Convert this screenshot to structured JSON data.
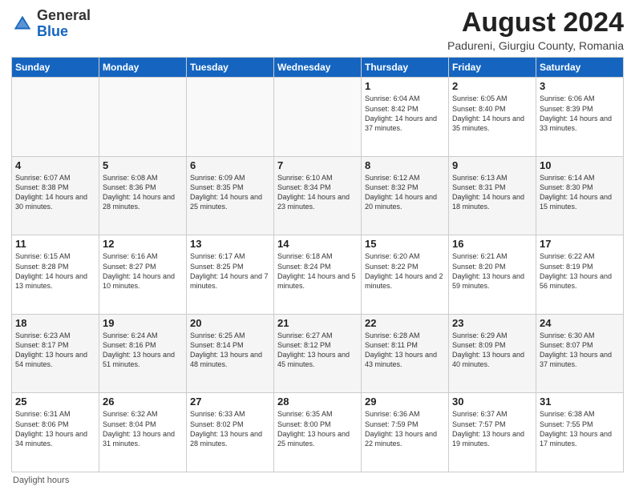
{
  "header": {
    "logo_general": "General",
    "logo_blue": "Blue",
    "month_year": "August 2024",
    "location": "Padureni, Giurgiu County, Romania"
  },
  "weekdays": [
    "Sunday",
    "Monday",
    "Tuesday",
    "Wednesday",
    "Thursday",
    "Friday",
    "Saturday"
  ],
  "footer": {
    "daylight_label": "Daylight hours"
  },
  "weeks": [
    [
      {
        "day": "",
        "info": ""
      },
      {
        "day": "",
        "info": ""
      },
      {
        "day": "",
        "info": ""
      },
      {
        "day": "",
        "info": ""
      },
      {
        "day": "1",
        "info": "Sunrise: 6:04 AM\nSunset: 8:42 PM\nDaylight: 14 hours\nand 37 minutes."
      },
      {
        "day": "2",
        "info": "Sunrise: 6:05 AM\nSunset: 8:40 PM\nDaylight: 14 hours\nand 35 minutes."
      },
      {
        "day": "3",
        "info": "Sunrise: 6:06 AM\nSunset: 8:39 PM\nDaylight: 14 hours\nand 33 minutes."
      }
    ],
    [
      {
        "day": "4",
        "info": "Sunrise: 6:07 AM\nSunset: 8:38 PM\nDaylight: 14 hours\nand 30 minutes."
      },
      {
        "day": "5",
        "info": "Sunrise: 6:08 AM\nSunset: 8:36 PM\nDaylight: 14 hours\nand 28 minutes."
      },
      {
        "day": "6",
        "info": "Sunrise: 6:09 AM\nSunset: 8:35 PM\nDaylight: 14 hours\nand 25 minutes."
      },
      {
        "day": "7",
        "info": "Sunrise: 6:10 AM\nSunset: 8:34 PM\nDaylight: 14 hours\nand 23 minutes."
      },
      {
        "day": "8",
        "info": "Sunrise: 6:12 AM\nSunset: 8:32 PM\nDaylight: 14 hours\nand 20 minutes."
      },
      {
        "day": "9",
        "info": "Sunrise: 6:13 AM\nSunset: 8:31 PM\nDaylight: 14 hours\nand 18 minutes."
      },
      {
        "day": "10",
        "info": "Sunrise: 6:14 AM\nSunset: 8:30 PM\nDaylight: 14 hours\nand 15 minutes."
      }
    ],
    [
      {
        "day": "11",
        "info": "Sunrise: 6:15 AM\nSunset: 8:28 PM\nDaylight: 14 hours\nand 13 minutes."
      },
      {
        "day": "12",
        "info": "Sunrise: 6:16 AM\nSunset: 8:27 PM\nDaylight: 14 hours\nand 10 minutes."
      },
      {
        "day": "13",
        "info": "Sunrise: 6:17 AM\nSunset: 8:25 PM\nDaylight: 14 hours\nand 7 minutes."
      },
      {
        "day": "14",
        "info": "Sunrise: 6:18 AM\nSunset: 8:24 PM\nDaylight: 14 hours\nand 5 minutes."
      },
      {
        "day": "15",
        "info": "Sunrise: 6:20 AM\nSunset: 8:22 PM\nDaylight: 14 hours\nand 2 minutes."
      },
      {
        "day": "16",
        "info": "Sunrise: 6:21 AM\nSunset: 8:20 PM\nDaylight: 13 hours\nand 59 minutes."
      },
      {
        "day": "17",
        "info": "Sunrise: 6:22 AM\nSunset: 8:19 PM\nDaylight: 13 hours\nand 56 minutes."
      }
    ],
    [
      {
        "day": "18",
        "info": "Sunrise: 6:23 AM\nSunset: 8:17 PM\nDaylight: 13 hours\nand 54 minutes."
      },
      {
        "day": "19",
        "info": "Sunrise: 6:24 AM\nSunset: 8:16 PM\nDaylight: 13 hours\nand 51 minutes."
      },
      {
        "day": "20",
        "info": "Sunrise: 6:25 AM\nSunset: 8:14 PM\nDaylight: 13 hours\nand 48 minutes."
      },
      {
        "day": "21",
        "info": "Sunrise: 6:27 AM\nSunset: 8:12 PM\nDaylight: 13 hours\nand 45 minutes."
      },
      {
        "day": "22",
        "info": "Sunrise: 6:28 AM\nSunset: 8:11 PM\nDaylight: 13 hours\nand 43 minutes."
      },
      {
        "day": "23",
        "info": "Sunrise: 6:29 AM\nSunset: 8:09 PM\nDaylight: 13 hours\nand 40 minutes."
      },
      {
        "day": "24",
        "info": "Sunrise: 6:30 AM\nSunset: 8:07 PM\nDaylight: 13 hours\nand 37 minutes."
      }
    ],
    [
      {
        "day": "25",
        "info": "Sunrise: 6:31 AM\nSunset: 8:06 PM\nDaylight: 13 hours\nand 34 minutes."
      },
      {
        "day": "26",
        "info": "Sunrise: 6:32 AM\nSunset: 8:04 PM\nDaylight: 13 hours\nand 31 minutes."
      },
      {
        "day": "27",
        "info": "Sunrise: 6:33 AM\nSunset: 8:02 PM\nDaylight: 13 hours\nand 28 minutes."
      },
      {
        "day": "28",
        "info": "Sunrise: 6:35 AM\nSunset: 8:00 PM\nDaylight: 13 hours\nand 25 minutes."
      },
      {
        "day": "29",
        "info": "Sunrise: 6:36 AM\nSunset: 7:59 PM\nDaylight: 13 hours\nand 22 minutes."
      },
      {
        "day": "30",
        "info": "Sunrise: 6:37 AM\nSunset: 7:57 PM\nDaylight: 13 hours\nand 19 minutes."
      },
      {
        "day": "31",
        "info": "Sunrise: 6:38 AM\nSunset: 7:55 PM\nDaylight: 13 hours\nand 17 minutes."
      }
    ]
  ]
}
